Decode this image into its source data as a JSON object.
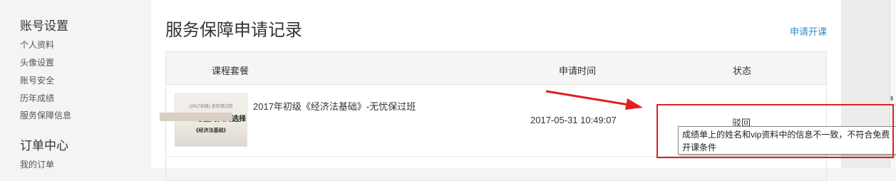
{
  "sidebar": {
    "group1_title": "账号设置",
    "group1_items": [
      "个人资料",
      "头像设置",
      "账号安全",
      "历年成绩",
      "服务保障信息"
    ],
    "group2_title": "订单中心",
    "group2_items": [
      "我的订单"
    ]
  },
  "main": {
    "title": "服务保障申请记录",
    "apply_link": "申请开课",
    "table": {
      "headers": [
        "课程套餐",
        "申请时间",
        "状态"
      ],
      "rows": [
        {
          "thumb_line1": "(2017初级) 无忧保过班",
          "thumb_line2": "76.8%考生的共同选择",
          "thumb_line3": "《经济法基础》",
          "course": "2017年初级《经济法基础》-无忧保过班",
          "time": "2017-05-31 10:49:07",
          "status": "驳回"
        }
      ]
    }
  },
  "tooltip": {
    "line1": "成绩单上的姓名和vip资料中的信息不一致，不符合免费",
    "line2": "开课条件"
  },
  "colors": {
    "link": "#2a8fd0",
    "annotation": "#e02020"
  }
}
